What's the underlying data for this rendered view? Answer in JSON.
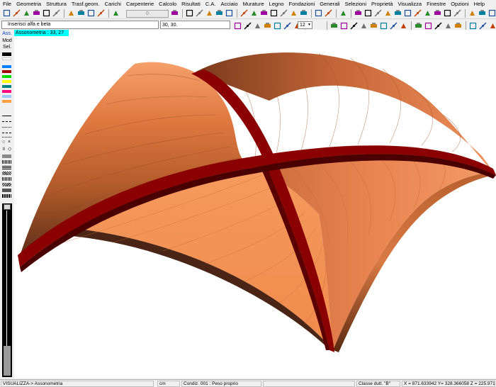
{
  "menubar": {
    "items": [
      "File",
      "Geometria",
      "Struttura",
      "Trasf.geom.",
      "Carichi",
      "Carpenterie",
      "Calcolo",
      "Risultati",
      "C.A.",
      "Acciaio",
      "Murature",
      "Legno",
      "Fondazioni",
      "Generali",
      "Selezioni",
      "Proprietà",
      "Visualizza",
      "Finestre",
      "Opzioni",
      "Help"
    ]
  },
  "toolbar": {
    "value_field": "0",
    "prompt_label": "Inserisci alfa e beta",
    "coord_input": "30, 30.",
    "size_combo": "12"
  },
  "palette": {
    "tab_ass": "Ass.",
    "tab_mod": "Mod",
    "tab_sel": "Sel.",
    "swatches": [
      "#000000",
      "#ffffff",
      "#0080ff",
      "#a00000",
      "#00e000",
      "#ffff00",
      "#008080",
      "#ff0080",
      "#a0c8ff",
      "#ffa040"
    ]
  },
  "viewport": {
    "title": "Assonometria :  33, 27",
    "vault_color": "#f08a4b",
    "rib_color": "#8b0000"
  },
  "statusbar": {
    "mode": "VISUALIZZA-> Assonometria",
    "unit": "cm",
    "load_condition": "Condiz. 001 : Peso proprio",
    "ductility_class": "Classe dutt. \"B\"",
    "coords": "X = 871.633942  Y= 328.366058  Z = 225.971538"
  }
}
